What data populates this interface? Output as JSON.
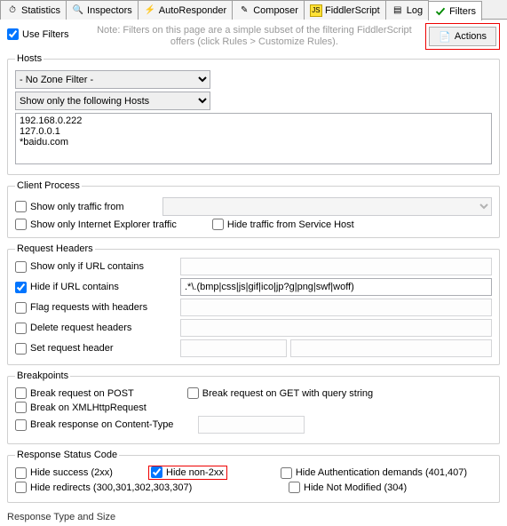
{
  "tabs": {
    "statistics": "Statistics",
    "inspectors": "Inspectors",
    "autoresponder": "AutoResponder",
    "composer": "Composer",
    "fiddlerscript": "FiddlerScript",
    "log": "Log",
    "filters": "Filters"
  },
  "topbar": {
    "use_filters": "Use Filters",
    "note": "Note: Filters on this page are a simple subset of the filtering FiddlerScript offers (click Rules > Customize Rules).",
    "actions": "Actions"
  },
  "hosts": {
    "legend": "Hosts",
    "zone_select": "- No Zone Filter -",
    "host_select": "Show only the following Hosts",
    "host_list": "192.168.0.222\n127.0.0.1\n*baidu.com"
  },
  "client_process": {
    "legend": "Client Process",
    "show_only": "Show only traffic from",
    "ie_only": "Show only Internet Explorer traffic",
    "hide_svchost": "Hide traffic from Service Host"
  },
  "request_headers": {
    "legend": "Request Headers",
    "show_url": "Show only if URL contains",
    "hide_url": "Hide if URL contains",
    "hide_url_value": ".*\\.(bmp|css|js|gif|ico|jp?g|png|swf|woff)",
    "flag": "Flag requests with headers",
    "delete": "Delete request headers",
    "set": "Set request header"
  },
  "breakpoints": {
    "legend": "Breakpoints",
    "post": "Break request on POST",
    "get_qs": "Break request on GET with query string",
    "xhr": "Break on XMLHttpRequest",
    "resp_ct": "Break response on Content-Type"
  },
  "status": {
    "legend": "Response Status Code",
    "hide_success": "Hide success (2xx)",
    "hide_non2xx": "Hide non-2xx",
    "hide_auth": "Hide Authentication demands (401,407)",
    "hide_redirects": "Hide redirects (300,301,302,303,307)",
    "hide_notmod": "Hide Not Modified (304)"
  },
  "footer": "Response Type and Size"
}
